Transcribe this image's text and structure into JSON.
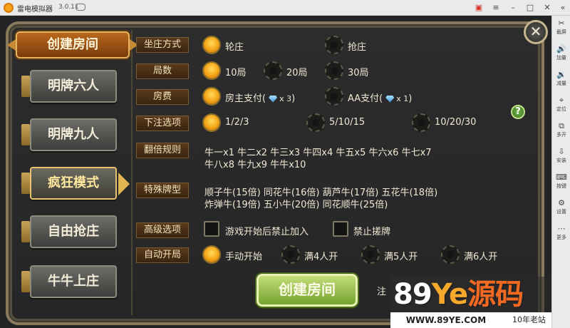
{
  "emulator": {
    "title": "雷电模拟器",
    "version": "3.0.11",
    "sidebar": [
      {
        "label": "截屏",
        "icon": "scissors-icon",
        "glyph": "✂"
      },
      {
        "label": "加量",
        "icon": "volume-up-icon",
        "glyph": "🔊"
      },
      {
        "label": "减量",
        "icon": "volume-down-icon",
        "glyph": "🔉"
      },
      {
        "label": "定位",
        "icon": "location-icon",
        "glyph": "⌖"
      },
      {
        "label": "多开",
        "icon": "multi-window-icon",
        "glyph": "⧉"
      },
      {
        "label": "安装",
        "icon": "install-apk-icon",
        "glyph": "⇩"
      },
      {
        "label": "按键",
        "icon": "keyboard-icon",
        "glyph": "⌨"
      },
      {
        "label": "设置",
        "icon": "gear-icon",
        "glyph": "⚙"
      },
      {
        "label": "更多",
        "icon": "more-icon",
        "glyph": "⋯"
      }
    ]
  },
  "modes": {
    "header": "创建房间",
    "items": [
      {
        "label": "明牌六人",
        "active": false
      },
      {
        "label": "明牌九人",
        "active": false
      },
      {
        "label": "疯狂模式",
        "active": true
      },
      {
        "label": "自由抢庄",
        "active": false
      },
      {
        "label": "牛牛上庄",
        "active": false
      }
    ]
  },
  "settings": {
    "banker": {
      "label": "坐庄方式",
      "options": [
        {
          "text": "轮庄",
          "on": true
        },
        {
          "text": "抢庄",
          "on": false
        }
      ]
    },
    "rounds": {
      "label": "局数",
      "options": [
        {
          "text": "10局",
          "on": true
        },
        {
          "text": "20局",
          "on": false
        },
        {
          "text": "30局",
          "on": false
        }
      ]
    },
    "fee": {
      "label": "房费",
      "options": [
        {
          "text": "房主支付",
          "gem_count": "x 3",
          "on": true
        },
        {
          "text": "AA支付",
          "gem_count": "x 1",
          "on": false
        }
      ]
    },
    "bet": {
      "label": "下注选项",
      "options": [
        {
          "text": "1/2/3",
          "on": true
        },
        {
          "text": "5/10/15",
          "on": false
        },
        {
          "text": "10/20/30",
          "on": false
        }
      ]
    },
    "multiplier": {
      "label": "翻倍规则",
      "line1": "牛一x1  牛二x2  牛三x3  牛四x4  牛五x5  牛六x6  牛七x7",
      "line2": "牛八x8  牛九x9  牛牛x10"
    },
    "special": {
      "label": "特殊牌型",
      "line1": "顺子牛(15倍)  同花牛(16倍)  葫芦牛(17倍)  五花牛(18倍)",
      "line2": "炸弹牛(19倍)  五小牛(20倍)  同花顺牛(25倍)"
    },
    "advanced": {
      "label": "高级选项",
      "options": [
        {
          "text": "游戏开始后禁止加入"
        },
        {
          "text": "禁止搓牌"
        }
      ]
    },
    "autostart": {
      "label": "自动开局",
      "options": [
        {
          "text": "手动开始",
          "on": true
        },
        {
          "text": "满4人开",
          "on": false
        },
        {
          "text": "满5人开",
          "on": false
        },
        {
          "text": "满6人开",
          "on": false
        }
      ]
    }
  },
  "help_label": "?",
  "close_label": "✕",
  "create_button": "创建房间",
  "note": "注",
  "watermark": {
    "part1": "89",
    "part2": "Ye",
    "part3": "源码",
    "url": "WWW.89YE.COM",
    "tag": "10年老站"
  }
}
